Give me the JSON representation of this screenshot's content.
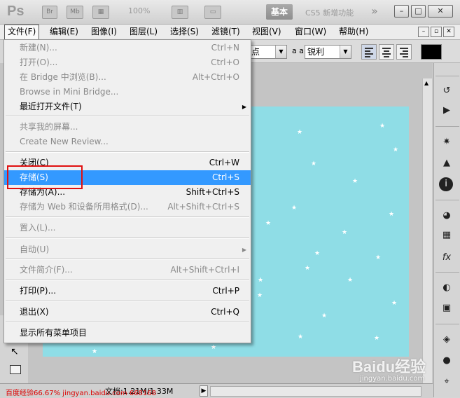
{
  "app": {
    "logo": "Ps",
    "toolbar_icons": [
      "Br",
      "Mb"
    ],
    "zoom": "100%",
    "workspace": "基本",
    "cs5_label": "CS5 新增功能",
    "more": "»",
    "window_buttons": [
      "–",
      "□",
      "✕"
    ]
  },
  "menubar": {
    "items": [
      "文件(F)",
      "编辑(E)",
      "图像(I)",
      "图层(L)",
      "选择(S)",
      "滤镜(T)",
      "视图(V)",
      "窗口(W)",
      "帮助(H)"
    ],
    "active_index": 0
  },
  "options_bar": {
    "font_style": "点",
    "aa_label": "a a",
    "antialias": "锐利"
  },
  "file_menu": {
    "items": [
      {
        "label": "新建(N)...",
        "shortcut": "Ctrl+N",
        "disabled": true
      },
      {
        "label": "打开(O)...",
        "shortcut": "Ctrl+O",
        "disabled": true
      },
      {
        "label": "在 Bridge 中浏览(B)...",
        "shortcut": "Alt+Ctrl+O",
        "disabled": true
      },
      {
        "label": "Browse in Mini Bridge...",
        "shortcut": "",
        "disabled": true
      },
      {
        "label": "最近打开文件(T)",
        "shortcut": "",
        "submenu": true
      },
      {
        "label": "共享我的屏幕...",
        "shortcut": "",
        "disabled": true
      },
      {
        "label": "Create New Review...",
        "shortcut": "",
        "disabled": true
      },
      {
        "label": "关闭(C)",
        "shortcut": "Ctrl+W"
      },
      {
        "label": "存储(S)",
        "shortcut": "Ctrl+S",
        "highlighted": true
      },
      {
        "label": "存储为(A)...",
        "shortcut": "Shift+Ctrl+S"
      },
      {
        "label": "存储为 Web 和设备所用格式(D)...",
        "shortcut": "Alt+Shift+Ctrl+S",
        "disabled": true
      },
      {
        "label": "置入(L)...",
        "shortcut": "",
        "disabled": true
      },
      {
        "label": "自动(U)",
        "shortcut": "",
        "disabled": true,
        "submenu": true
      },
      {
        "label": "文件简介(F)...",
        "shortcut": "Alt+Shift+Ctrl+I",
        "disabled": true
      },
      {
        "label": "打印(P)...",
        "shortcut": "Ctrl+P"
      },
      {
        "label": "退出(X)",
        "shortcut": "Ctrl+Q"
      },
      {
        "label": "显示所有菜单项目",
        "shortcut": ""
      }
    ]
  },
  "status": {
    "doc_info": "文档:1.21M/1.33M",
    "zoom_text": "百度经验66.67%  jingyan.baidu.com  668168"
  },
  "watermark": {
    "logo": "Baidu经验",
    "url": "jingyan.baidu.com"
  },
  "colors": {
    "highlight": "#3399ff",
    "canvas": "#8fdde6",
    "annotation_box": "#e01010"
  }
}
